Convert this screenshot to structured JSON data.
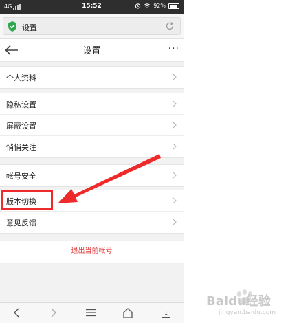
{
  "status_bar": {
    "network": "4G",
    "time": "15:52",
    "battery": "92%"
  },
  "browser": {
    "address": "设置",
    "tab_count": "1"
  },
  "header": {
    "title": "设置",
    "more": "···"
  },
  "groups": [
    [
      "个人资料"
    ],
    [
      "隐私设置",
      "屏蔽设置",
      "悄悄关注"
    ],
    [
      "帐号安全"
    ],
    [
      "版本切换",
      "意见反馈"
    ]
  ],
  "logout_label": "退出当前帐号",
  "colors": {
    "logout_text": "#e03a3a",
    "highlight": "#ee2a2a",
    "shield": "#2fa84f"
  },
  "watermark": {
    "text": "Baidu经验",
    "url": "jingyan.baidu.com"
  },
  "icons": [
    "signal-icon",
    "alarm-icon",
    "wifi-icon",
    "battery-icon",
    "shield-icon",
    "reload-icon",
    "back-arrow-icon",
    "more-icon",
    "chevron-right-icon",
    "nav-back-icon",
    "nav-forward-icon",
    "menu-icon",
    "home-icon",
    "tabs-icon"
  ]
}
